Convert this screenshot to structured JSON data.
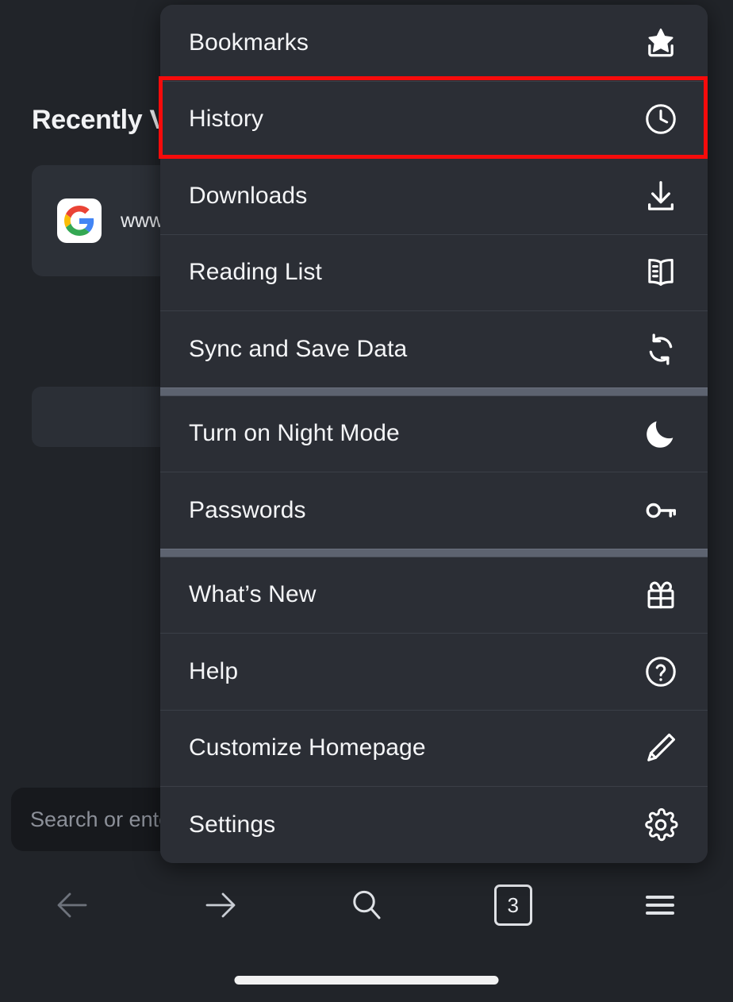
{
  "background": {
    "heading": "Recently Visited",
    "recent_site": {
      "favicon": "google-icon",
      "url": "www.google.com"
    },
    "url_bar_placeholder": "Search or enter address"
  },
  "bottom_toolbar": {
    "items": [
      {
        "name": "back-button",
        "icon": "arrow-left-icon",
        "label": "Back",
        "enabled": false
      },
      {
        "name": "forward-button",
        "icon": "arrow-right-icon",
        "label": "Forward",
        "enabled": true
      },
      {
        "name": "search-button",
        "icon": "search-icon",
        "label": "Search",
        "enabled": true
      },
      {
        "name": "tabs-button",
        "icon": "tab-count-icon",
        "label": "Tabs",
        "enabled": true
      },
      {
        "name": "menu-button",
        "icon": "hamburger-icon",
        "label": "Menu",
        "enabled": true
      }
    ],
    "tab_count": "3"
  },
  "menu": {
    "groups": [
      {
        "items": [
          {
            "label": "Bookmarks",
            "icon": "bookmark-star-icon"
          },
          {
            "label": "History",
            "icon": "clock-icon",
            "highlighted": true
          },
          {
            "label": "Downloads",
            "icon": "download-icon"
          },
          {
            "label": "Reading List",
            "icon": "open-book-icon"
          },
          {
            "label": "Sync and Save Data",
            "icon": "sync-icon"
          }
        ]
      },
      {
        "items": [
          {
            "label": "Turn on Night Mode",
            "icon": "moon-icon"
          },
          {
            "label": "Passwords",
            "icon": "key-icon"
          }
        ]
      },
      {
        "items": [
          {
            "label": "What’s New",
            "icon": "gift-icon"
          },
          {
            "label": "Help",
            "icon": "question-circle-icon"
          },
          {
            "label": "Customize Homepage",
            "icon": "pencil-icon"
          },
          {
            "label": "Settings",
            "icon": "gear-icon"
          }
        ]
      }
    ]
  },
  "highlight": {
    "target": "History",
    "color": "#f60b0b"
  },
  "colors": {
    "page_background": "#212429",
    "menu_background": "#2b2e35",
    "menu_text": "#f4f5f7",
    "divider_thin": "#3b3f47",
    "divider_thick": "#5d6370",
    "highlight_red": "#f60b0b"
  }
}
